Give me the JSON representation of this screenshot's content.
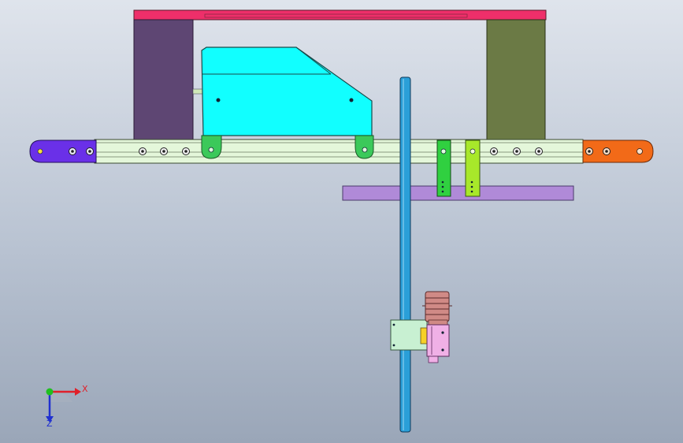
{
  "viewport": {
    "background_top": "#dfe4ec",
    "background_bottom": "#9aa6b8"
  },
  "triad": {
    "x_label": "X",
    "z_label": "Z",
    "x_color": "#e0202a",
    "y_color": "#20c020",
    "z_color": "#2030d0"
  },
  "parts": {
    "top_beam": {
      "color": "#ee2f6a"
    },
    "left_plate": {
      "color": "#5e4673"
    },
    "right_plate": {
      "color": "#6b7a45"
    },
    "rail": {
      "color": "#e4f7da"
    },
    "left_end_cap": {
      "color": "#6a30e8"
    },
    "right_end_cap": {
      "color": "#f26a18"
    },
    "cover_housing": {
      "color": "#11ffff"
    },
    "carriage_feet": {
      "color": "#3bc95a"
    },
    "vertical_shaft": {
      "color": "#2a9fd8"
    },
    "slider_green_left": {
      "color": "#30d040"
    },
    "slider_green_right": {
      "color": "#a8e82a"
    },
    "purple_bar": {
      "color": "#b08ad8"
    },
    "motor_coupling": {
      "color": "#d08a86"
    },
    "motor_body": {
      "color": "#f0b0e6"
    },
    "mount_bracket": {
      "color": "#c8f0d2"
    },
    "yellow_block": {
      "color": "#f6d028"
    }
  }
}
